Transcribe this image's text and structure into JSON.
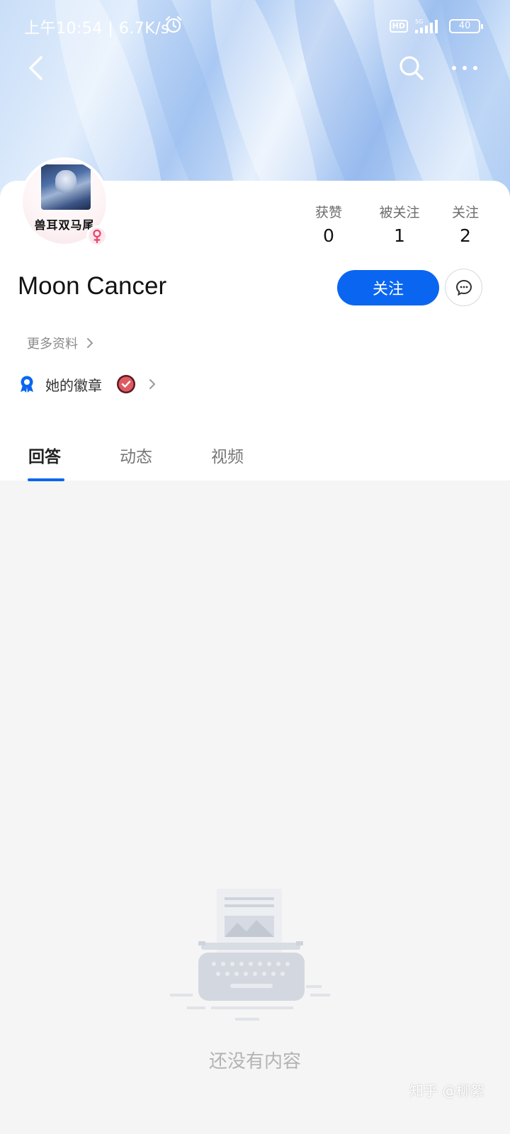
{
  "status_bar": {
    "time": "上午10:54",
    "speed": "6.7K/s",
    "hd": "HD",
    "network": "5G",
    "battery": "40"
  },
  "nav": {
    "back_icon": "chevron-left-icon",
    "search_icon": "search-icon",
    "more_icon": "more-horizontal-icon"
  },
  "profile": {
    "avatar_text": "兽耳双马尾",
    "gender_icon": "female-icon",
    "name": "Moon Cancer",
    "stats": [
      {
        "label": "获赞",
        "value": "0"
      },
      {
        "label": "被关注",
        "value": "1"
      },
      {
        "label": "关注",
        "value": "2"
      }
    ],
    "follow_label": "关注",
    "chat_icon": "chat-bubble-icon",
    "more_info_label": "更多资料",
    "badges_label": "她的徽章"
  },
  "tabs": [
    {
      "label": "回答",
      "active": true
    },
    {
      "label": "动态",
      "active": false
    },
    {
      "label": "视频",
      "active": false
    }
  ],
  "empty_state": {
    "text": "还没有内容",
    "icon": "typewriter-icon"
  },
  "watermark": "知乎 @柳絮",
  "colors": {
    "accent": "#0a66f0",
    "header_bg": "#bcd6f6",
    "page_bg": "#f5f5f5"
  }
}
